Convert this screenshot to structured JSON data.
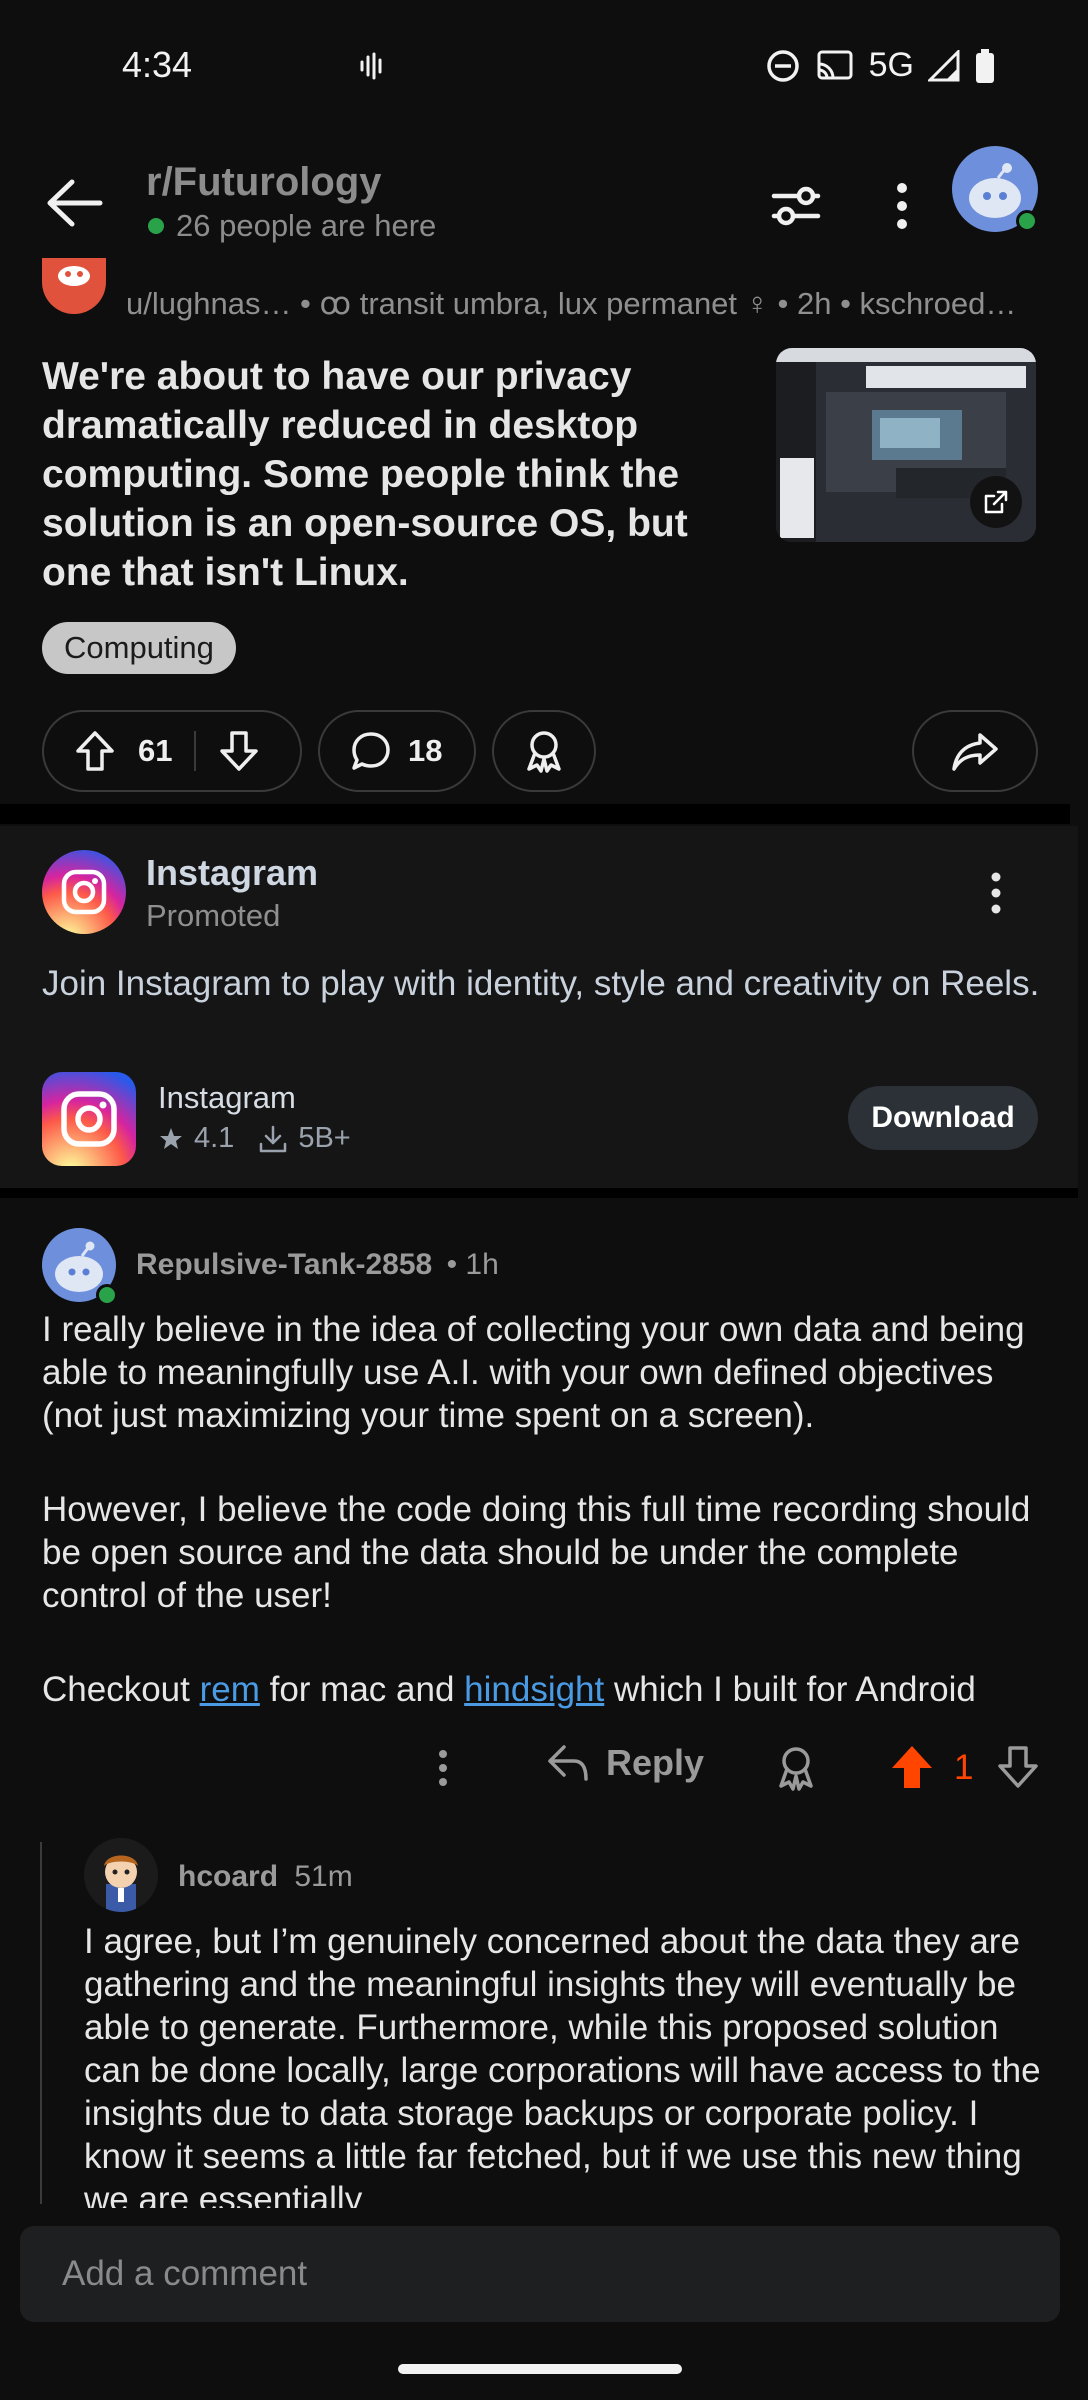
{
  "status_bar": {
    "time": "4:34",
    "network": "5G"
  },
  "header": {
    "subreddit": "r/Futurology",
    "online_text": "26 people are here"
  },
  "post": {
    "meta": "u/lughnas… • ꝏ transit umbra, lux permanet ♀ • 2h • kschroed…",
    "title": "We're about to have our privacy dramatically reduced in desktop computing. Some people think the solution is an open-source OS, but one that isn't Linux.",
    "flair": "Computing",
    "upvotes": "61",
    "comments": "18"
  },
  "ad": {
    "name": "Instagram",
    "promoted": "Promoted",
    "text": "Join Instagram to play with identity, style and creativity on Reels.",
    "app_name": "Instagram",
    "rating": "4.1",
    "downloads": "5B+",
    "download_label": "Download"
  },
  "comment": {
    "author": "Repulsive-Tank-2858",
    "time": "• 1h",
    "p1": "I really believe in the idea of collecting your own data and being able to meaningfully use A.I. with your own defined objectives (not just maximizing your time spent on a screen).",
    "p2": "However, I believe the code doing this full time recording should be open source and the data should be under the complete control of the user!",
    "p3_a": "Checkout ",
    "link1": "rem",
    "p3_b": " for mac and ",
    "link2": "hindsight",
    "p3_c": " which I built for Android",
    "reply_label": "Reply",
    "votes": "1"
  },
  "reply": {
    "author": "hcoard",
    "time": "51m",
    "body": "I agree, but I’m genuinely concerned about the data they are gathering and the meaningful insights they will eventually be able to generate. Furthermore, while this proposed solution can be done locally, large corporations will have access to the insights due to data storage backups or corporate policy. I know it seems a little far fetched, but if we use this new thing we are essentially"
  },
  "composer": {
    "placeholder": "Add a comment"
  },
  "colors": {
    "accent_upvote": "#ff4500",
    "link": "#4a9be3",
    "online": "#2aa24a"
  }
}
